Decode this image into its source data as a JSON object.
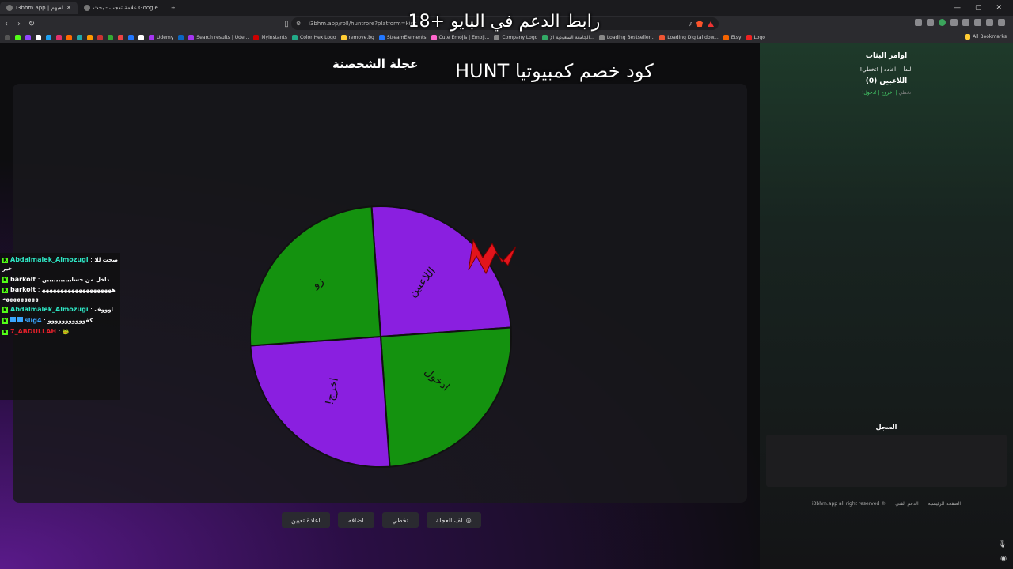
{
  "browser": {
    "tabs": [
      {
        "label": "I3bhm.app | لعبهم",
        "active": true
      },
      {
        "label": "علامة تعجب - بحث Google",
        "active": false
      }
    ],
    "new_tab": "+",
    "url": "i3bhm.app/roll/huntrore?platform=kick",
    "bookmarks": [
      "Udemy",
      "Search results | Ude...",
      "Myinstants",
      "Color Hex Logo",
      "remove.bg",
      "StreamElements",
      "Cute Emojis | Emoji...",
      "Company Logo",
      "الجامعة السعودية الإ...",
      "Loading Bestseller...",
      "Loading Digital dow...",
      "Etsy",
      "Logo"
    ],
    "all_bookmarks": "All Bookmarks",
    "overlay_text": "رابط الدعم في البايو +18"
  },
  "page": {
    "title": "عجلة الشخصنة",
    "overlay_hunt": "HUNT كود خصم كمبيوتيا"
  },
  "wheel": {
    "segments": [
      {
        "label": "اللاعبين",
        "color": "#8a1fe0"
      },
      {
        "label": "ادخول",
        "color": "#14920f"
      },
      {
        "label": "!اخرج",
        "color": "#8a1fe0"
      },
      {
        "label": "زو",
        "color": "#14920f"
      }
    ],
    "pointer_color": "#e3141b"
  },
  "buttons": {
    "spin": "لف العجلة",
    "skip": "تخطي",
    "add": "اضافه",
    "reset": "اعادة تعيين"
  },
  "sidebar": {
    "title": "اوامر البثات",
    "commands": "!البدأ | !اعاده | !تخطي",
    "players": "اللاعبين (0)",
    "join": "!دخول",
    "leave": "!خروج",
    "skip": "!تخطي",
    "log_title": "السجل",
    "footer_rights": "i3bhm.app all right reserved ©",
    "footer_support": "الدعم الفني",
    "footer_home": "الصفحة الرئيسية"
  },
  "chat": [
    {
      "user": "Abdalmalek_Almozugi",
      "color": "#2ee6c4",
      "text": "صحت للاخير"
    },
    {
      "user": "barkolt",
      "color": "#ffffff",
      "text": "داخل من حسابيييييييييين"
    },
    {
      "user": "barkolt",
      "color": "#ffffff",
      "text": "هههههههههههههههههههههههههههههه"
    },
    {
      "user": "Abdalmalek_Almozugi",
      "color": "#2ee6c4",
      "text": "اوووف"
    },
    {
      "user": "slig4",
      "color": "#3aa6ff",
      "text": "كفووووووووووو"
    },
    {
      "user": "7_ABDULLAH",
      "color": "#e0202a",
      "text": "🐸"
    }
  ]
}
